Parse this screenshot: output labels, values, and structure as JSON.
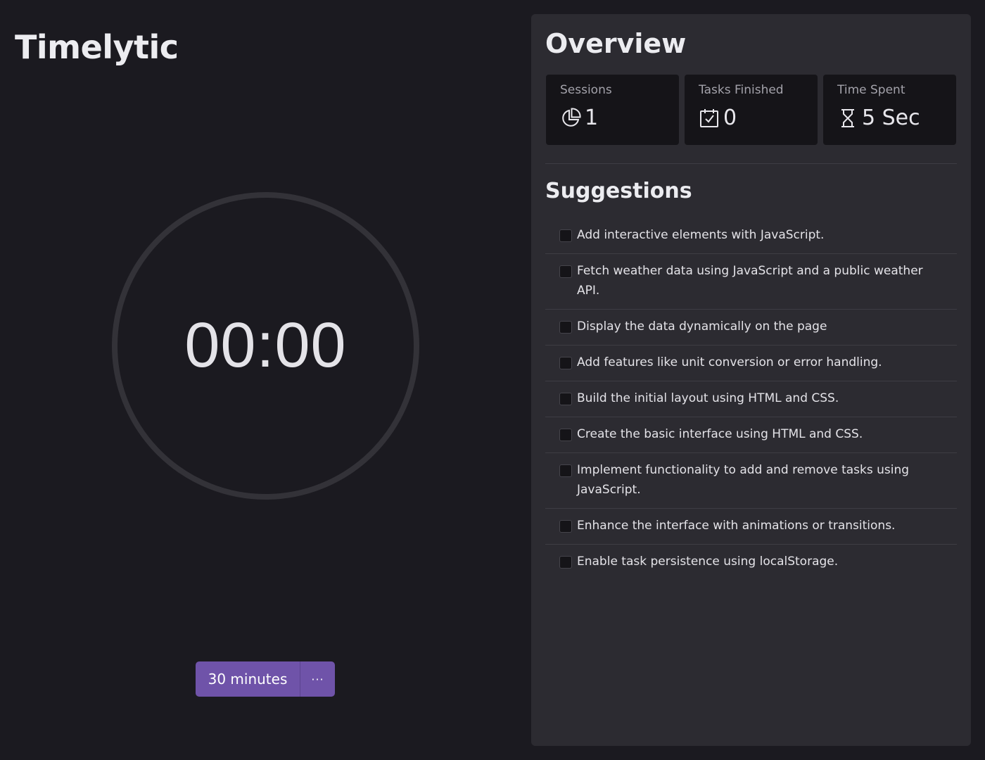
{
  "app": {
    "title": "Timelytic"
  },
  "timer": {
    "display": "00:00",
    "duration_label": "30 minutes",
    "more_label": "···"
  },
  "overview": {
    "title": "Overview",
    "stats": [
      {
        "label": "Sessions",
        "value": "1",
        "icon": "pie-chart-icon"
      },
      {
        "label": "Tasks Finished",
        "value": "0",
        "icon": "calendar-check-icon"
      },
      {
        "label": "Time Spent",
        "value": "5 Sec",
        "icon": "hourglass-icon"
      }
    ]
  },
  "suggestions": {
    "title": "Suggestions",
    "items": [
      {
        "text": "Add interactive elements with JavaScript.",
        "checked": false
      },
      {
        "text": "Fetch weather data using JavaScript and a public weather API.",
        "checked": false
      },
      {
        "text": "Display the data dynamically on the page",
        "checked": false
      },
      {
        "text": "Add features like unit conversion or error handling.",
        "checked": false
      },
      {
        "text": "Build the initial layout using HTML and CSS.",
        "checked": false
      },
      {
        "text": "Create the basic interface using HTML and CSS.",
        "checked": false
      },
      {
        "text": "Implement functionality to add and remove tasks using JavaScript.",
        "checked": false
      },
      {
        "text": "Enhance the interface with animations or transitions.",
        "checked": false
      },
      {
        "text": "Enable task persistence using localStorage.",
        "checked": false
      }
    ]
  },
  "colors": {
    "accent": "#6f53a9",
    "background": "#1b1a20",
    "panel": "#2c2b31",
    "card": "#151418"
  }
}
